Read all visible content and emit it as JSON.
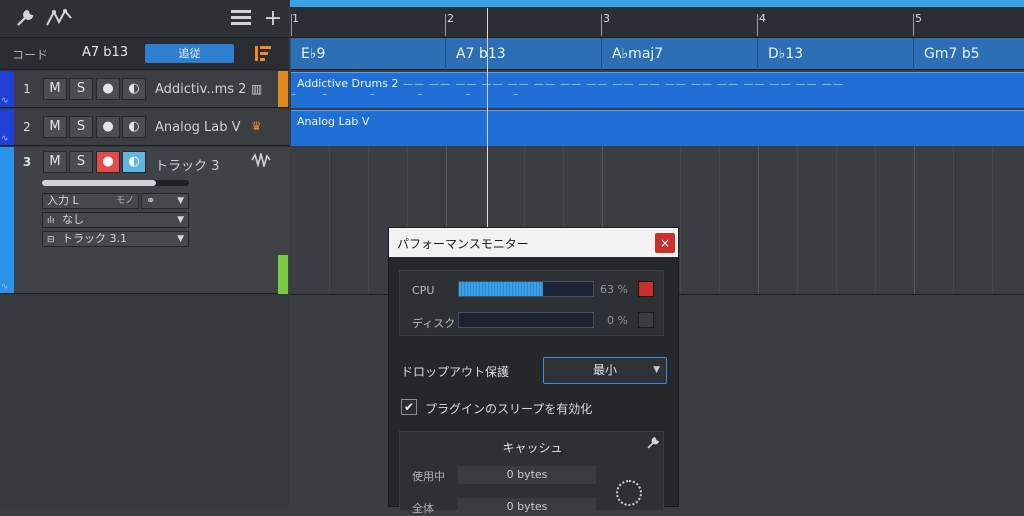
{
  "toolbar": {
    "wrench_icon": "wrench-icon",
    "automation_icon": "automation-icon",
    "list_icon": "list-icon",
    "add_icon": "plus-icon"
  },
  "chord_header": {
    "label": "コード",
    "value": "A7 b13",
    "follow_label": "追従"
  },
  "tracks": [
    {
      "num": "1",
      "m": "M",
      "s": "S",
      "name": "Addictiv..ms 2",
      "color": "#1f6fd6",
      "strip": "#e08a1e"
    },
    {
      "num": "2",
      "m": "M",
      "s": "S",
      "name": "Analog Lab V",
      "color": "#1f6fd6",
      "strip": "#3b3e42"
    },
    {
      "num": "3",
      "m": "M",
      "s": "S",
      "name": "トラック 3",
      "color": "#2a92e8",
      "strip": "#7ac943"
    }
  ],
  "track3_io": {
    "input": "入力 L",
    "mono": "モノ",
    "output": "なし",
    "channel": "トラック 3.1"
  },
  "ruler": {
    "bars": [
      "1",
      "2",
      "3",
      "4",
      "5"
    ]
  },
  "chords": [
    "E♭9",
    "A7 b13",
    "A♭maj7",
    "D♭13",
    "Gm7 b5"
  ],
  "clips": [
    {
      "name": "Addictive Drums 2"
    },
    {
      "name": "Analog Lab V"
    }
  ],
  "perf": {
    "title": "パフォーマンスモニター",
    "close": "×",
    "cpu_label": "CPU",
    "cpu_pct": "63 %",
    "cpu_level": 0.63,
    "disk_label": "ディスク",
    "disk_pct": "0 %",
    "disk_level": 0,
    "dropout_label": "ドロップアウト保護",
    "dropout_value": "最小",
    "sleep_label": "プラグインのスリープを有効化",
    "sleep_checked": "✔",
    "cache_title": "キャッシュ",
    "used_label": "使用中",
    "used_value": "0 bytes",
    "total_label": "全体",
    "total_value": "0 bytes"
  },
  "colors": {
    "accent": "#3aa3e8",
    "cpu_led": "#c9302c",
    "clip": "#1f6fd6"
  }
}
